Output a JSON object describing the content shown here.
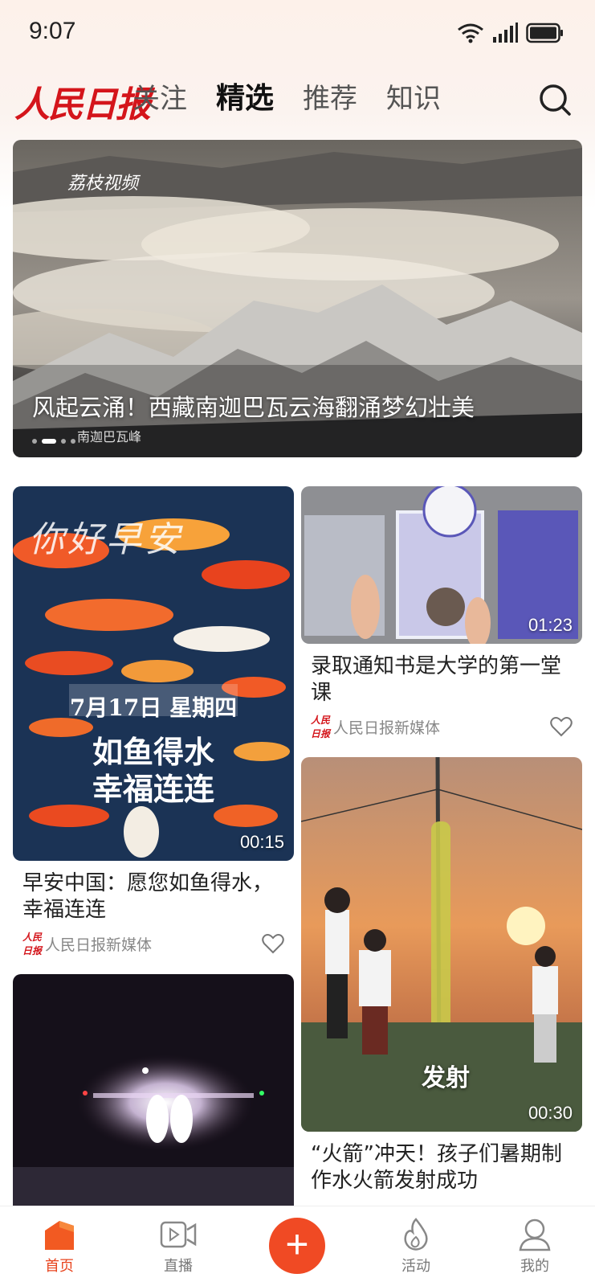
{
  "status": {
    "time": "9:07"
  },
  "header": {
    "logo_text": "人民日报",
    "tabs": [
      {
        "label": "关注"
      },
      {
        "label": "精选",
        "active": true
      },
      {
        "label": "推荐"
      },
      {
        "label": "知识"
      }
    ]
  },
  "banner": {
    "badge": "荔枝视频",
    "title": "风起云涌！西藏南迦巴瓦云海翻涌梦幻壮美",
    "location": "南迦巴瓦峰"
  },
  "cards": [
    {
      "title": "早安中国：愿您如鱼得水，幸福连连",
      "duration": "00:15",
      "source": "人民日报新媒体",
      "overlay_date": "7月17日 星期四",
      "overlay_line1": "如鱼得水",
      "overlay_line2": "幸福连连",
      "overlay_calligraphy": "你好早安"
    },
    {
      "title": "录取通知书是大学的第一堂课",
      "duration": "01:23",
      "source": "人民日报新媒体"
    },
    {
      "title": "“火箭”冲天！孩子们暑期制作水火箭发射成功",
      "duration": "00:30",
      "overlay_text": "发射"
    }
  ],
  "bottom_nav": [
    {
      "label": "首页",
      "icon": "home-icon",
      "active": true
    },
    {
      "label": "直播",
      "icon": "live-video-icon"
    },
    {
      "label": "+",
      "icon": "add-icon"
    },
    {
      "label": "活动",
      "icon": "flame-icon"
    },
    {
      "label": "我的",
      "icon": "profile-icon"
    }
  ],
  "colors": {
    "accent": "#e8441e",
    "logo_red": "#d4151b"
  }
}
